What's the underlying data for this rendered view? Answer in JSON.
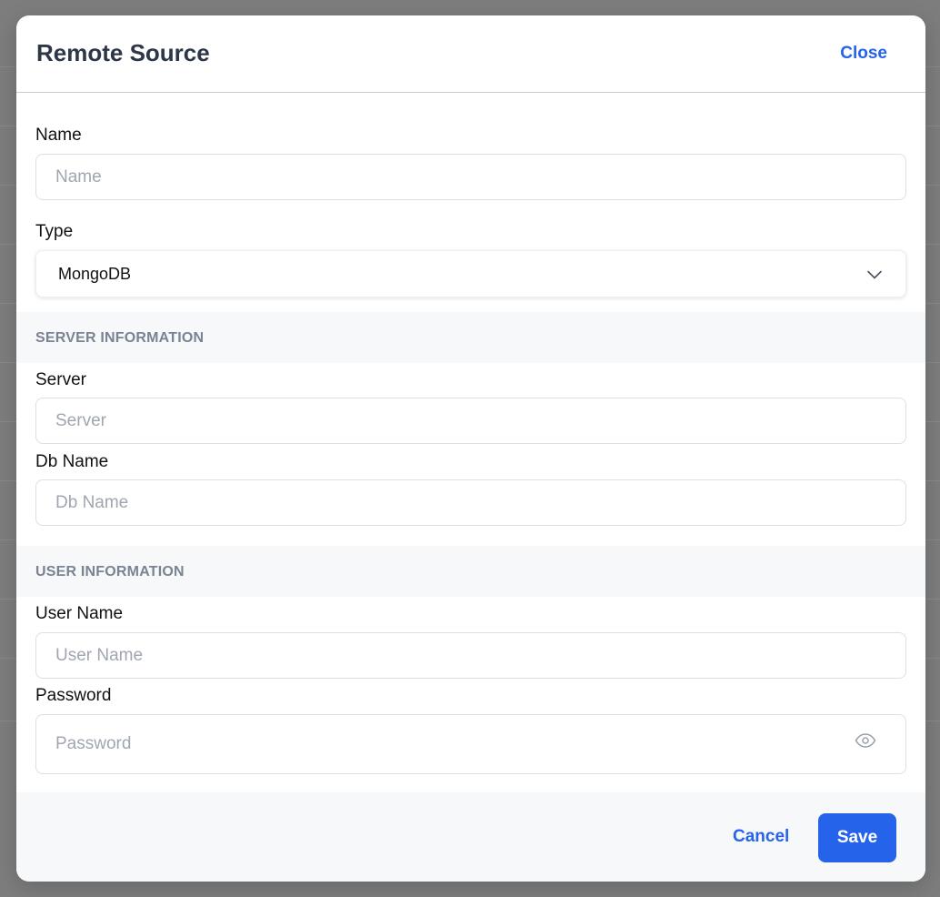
{
  "modal": {
    "title": "Remote Source",
    "close_label": "Close"
  },
  "fields": {
    "name": {
      "label": "Name",
      "placeholder": "Name",
      "value": ""
    },
    "type": {
      "label": "Type",
      "value": "MongoDB"
    }
  },
  "sections": {
    "server": {
      "title": "SERVER INFORMATION",
      "server": {
        "label": "Server",
        "placeholder": "Server"
      },
      "db_name": {
        "label": "Db Name",
        "placeholder": "Db Name"
      }
    },
    "user": {
      "title": "USER INFORMATION",
      "user_name": {
        "label": "User Name",
        "placeholder": "User Name"
      },
      "password": {
        "label": "Password",
        "placeholder": "Password"
      }
    }
  },
  "footer": {
    "cancel_label": "Cancel",
    "save_label": "Save"
  },
  "colors": {
    "accent": "#2563eb",
    "title": "#2d3748",
    "section_text": "#7a8392",
    "section_bg": "#f7f8fa",
    "overlay": "#7d7d7d"
  },
  "icons": {
    "select": "chevron-down-icon",
    "password": "eye-icon"
  }
}
